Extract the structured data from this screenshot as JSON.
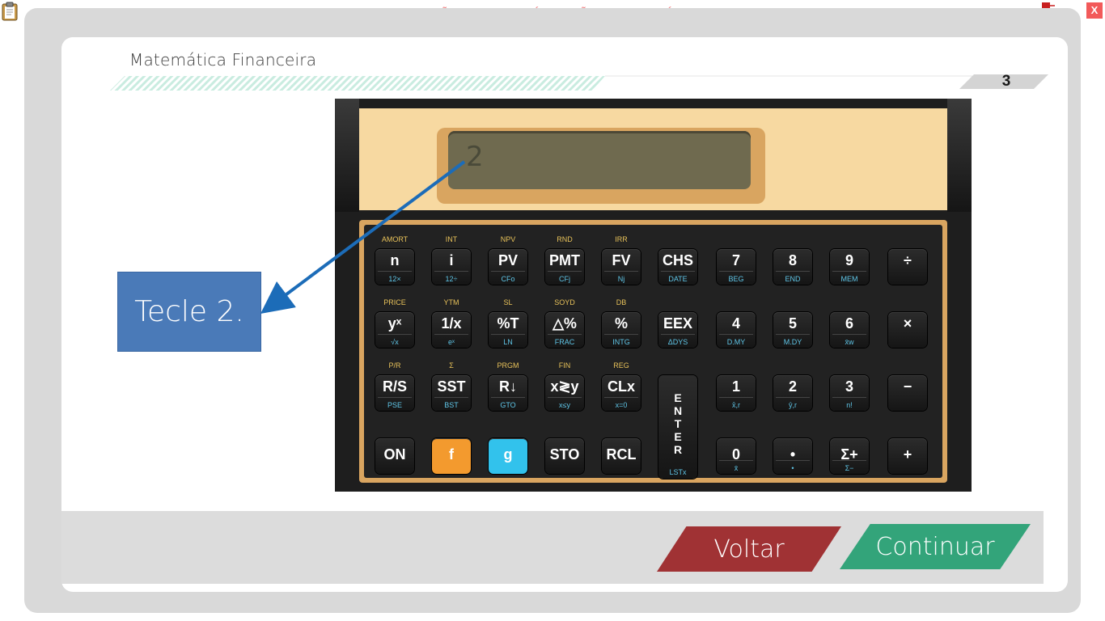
{
  "topbar": {
    "banner_text": "VERSÃO PARA FUNCIONÁRIOS - NÃO COMERCIALIZÁVEL",
    "close_label": "X"
  },
  "lesson": {
    "title": "Matemática Financeira",
    "page_number": "3",
    "callout_text": "Tecle 2."
  },
  "calculator": {
    "display_value": "2",
    "rows": [
      [
        {
          "gold": "AMORT",
          "main": "n",
          "blue": "12×"
        },
        {
          "gold": "INT",
          "main": "i",
          "blue": "12÷"
        },
        {
          "gold": "NPV",
          "main": "PV",
          "blue": "CFo"
        },
        {
          "gold": "RND",
          "main": "PMT",
          "blue": "CFj"
        },
        {
          "gold": "IRR",
          "main": "FV",
          "blue": "Nj"
        },
        {
          "gold": "",
          "main": "CHS",
          "blue": "DATE"
        },
        {
          "gold": "",
          "main": "7",
          "blue": "BEG"
        },
        {
          "gold": "",
          "main": "8",
          "blue": "END"
        },
        {
          "gold": "",
          "main": "9",
          "blue": "MEM"
        },
        {
          "gold": "",
          "main": "÷",
          "blue": ""
        }
      ],
      [
        {
          "gold": "PRICE",
          "main": "yˣ",
          "blue": "√x"
        },
        {
          "gold": "YTM",
          "main": "1/x",
          "blue": "eˣ"
        },
        {
          "gold": "SL",
          "main": "%T",
          "blue": "LN"
        },
        {
          "gold": "SOYD",
          "main": "△%",
          "blue": "FRAC"
        },
        {
          "gold": "DB",
          "main": "%",
          "blue": "INTG"
        },
        {
          "gold": "",
          "main": "EEX",
          "blue": "ΔDYS"
        },
        {
          "gold": "",
          "main": "4",
          "blue": "D.MY"
        },
        {
          "gold": "",
          "main": "5",
          "blue": "M.DY"
        },
        {
          "gold": "",
          "main": "6",
          "blue": "x̄w"
        },
        {
          "gold": "",
          "main": "×",
          "blue": ""
        }
      ],
      [
        {
          "gold": "P/R",
          "main": "R/S",
          "blue": "PSE"
        },
        {
          "gold": "Σ",
          "main": "SST",
          "blue": "BST"
        },
        {
          "gold": "PRGM",
          "main": "R↓",
          "blue": "GTO"
        },
        {
          "gold": "FIN",
          "main": "x≷y",
          "blue": "x≤y"
        },
        {
          "gold": "REG",
          "main": "CLx",
          "blue": "x=0"
        },
        {
          "gold": "",
          "main": "",
          "blue": ""
        },
        {
          "gold": "",
          "main": "1",
          "blue": "x̂,r"
        },
        {
          "gold": "",
          "main": "2",
          "blue": "ŷ,r"
        },
        {
          "gold": "",
          "main": "3",
          "blue": "n!"
        },
        {
          "gold": "",
          "main": "−",
          "blue": ""
        }
      ],
      [
        {
          "gold": "",
          "main": "ON",
          "blue": ""
        },
        {
          "gold": "",
          "main": "f",
          "blue": ""
        },
        {
          "gold": "",
          "main": "g",
          "blue": ""
        },
        {
          "gold": "",
          "main": "STO",
          "blue": ""
        },
        {
          "gold": "",
          "main": "RCL",
          "blue": ""
        },
        {
          "gold": "",
          "main": "",
          "blue": ""
        },
        {
          "gold": "",
          "main": "0",
          "blue": "x̄"
        },
        {
          "gold": "",
          "main": "•",
          "blue": "•"
        },
        {
          "gold": "",
          "main": "Σ+",
          "blue": "Σ−"
        },
        {
          "gold": "",
          "main": "+",
          "blue": ""
        }
      ]
    ],
    "enter": {
      "main": "E\nN\nT\nE\nR",
      "blue": "LSTx"
    }
  },
  "footer": {
    "back_label": "Voltar",
    "continue_label": "Continuar"
  },
  "colors": {
    "back_button": "#a03234",
    "continue_button": "#33a47a",
    "callout": "#4a7ab8",
    "key_f": "#f39a2e",
    "key_g": "#32c2ec",
    "arrow": "#1c6cb8"
  },
  "icons": [
    "clipboard-icon",
    "network-status-icon",
    "arrow-icon"
  ]
}
